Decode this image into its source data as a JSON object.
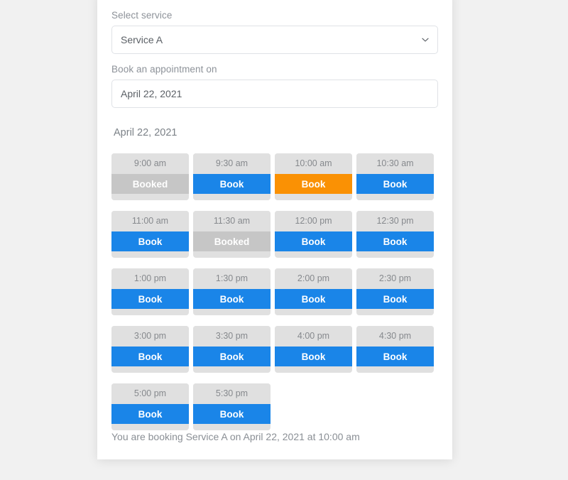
{
  "form": {
    "service_label": "Select service",
    "service_value": "Service A",
    "service_options": [
      "Service A"
    ],
    "date_label": "Book an appointment on",
    "date_value": "April 22, 2021",
    "chevron_icon": "chevron-down-icon"
  },
  "schedule": {
    "date_heading": "April 22, 2021",
    "slots": [
      {
        "time": "9:00 am",
        "action": "Booked",
        "state": "booked"
      },
      {
        "time": "9:30 am",
        "action": "Book",
        "state": "available"
      },
      {
        "time": "10:00 am",
        "action": "Book",
        "state": "selected"
      },
      {
        "time": "10:30 am",
        "action": "Book",
        "state": "available"
      },
      {
        "time": "11:00 am",
        "action": "Book",
        "state": "available"
      },
      {
        "time": "11:30 am",
        "action": "Booked",
        "state": "booked"
      },
      {
        "time": "12:00 pm",
        "action": "Book",
        "state": "available"
      },
      {
        "time": "12:30 pm",
        "action": "Book",
        "state": "available"
      },
      {
        "time": "1:00 pm",
        "action": "Book",
        "state": "available"
      },
      {
        "time": "1:30 pm",
        "action": "Book",
        "state": "available"
      },
      {
        "time": "2:00 pm",
        "action": "Book",
        "state": "available"
      },
      {
        "time": "2:30 pm",
        "action": "Book",
        "state": "available"
      },
      {
        "time": "3:00 pm",
        "action": "Book",
        "state": "available"
      },
      {
        "time": "3:30 pm",
        "action": "Book",
        "state": "available"
      },
      {
        "time": "4:00 pm",
        "action": "Book",
        "state": "available"
      },
      {
        "time": "4:30 pm",
        "action": "Book",
        "state": "available"
      },
      {
        "time": "5:00 pm",
        "action": "Book",
        "state": "available"
      },
      {
        "time": "5:30 pm",
        "action": "Book",
        "state": "available"
      }
    ]
  },
  "summary": {
    "text": "You are booking Service A on April 22, 2021 at 10:00 am"
  },
  "colors": {
    "page_background": "#f1f1f1",
    "panel_background": "#ffffff",
    "slot_background": "#e0e0e0",
    "available": "#1a85e8",
    "selected": "#fa9104",
    "booked": "#c6c6c6",
    "muted_text": "#8a8f95"
  }
}
